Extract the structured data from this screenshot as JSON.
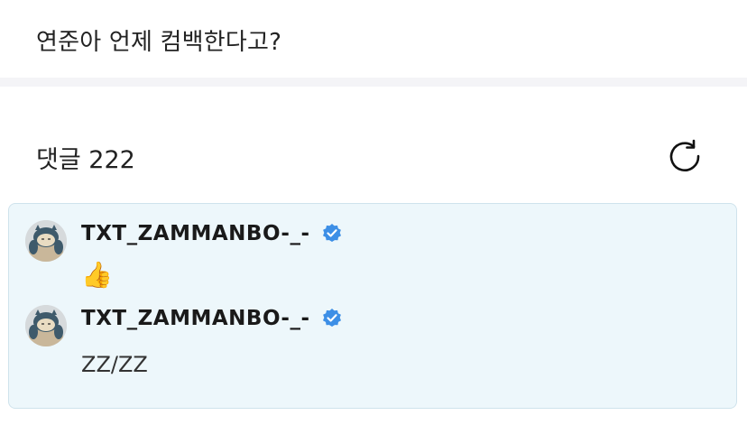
{
  "post": {
    "title": "연준아 언제 컴백한다고?"
  },
  "comments_section": {
    "header": "댓글 222",
    "refresh_icon": "refresh-icon"
  },
  "comments": [
    {
      "author": "TXT_ZAMMANBO-_-",
      "verified": true,
      "text": "👍"
    },
    {
      "author": "TXT_ZAMMANBO-_-",
      "verified": true,
      "text": "ZZ/ZZ"
    }
  ],
  "colors": {
    "verified_badge": "#3d8fe6",
    "comment_bg": "#edf7fb",
    "comment_border": "#cfe3ec"
  }
}
